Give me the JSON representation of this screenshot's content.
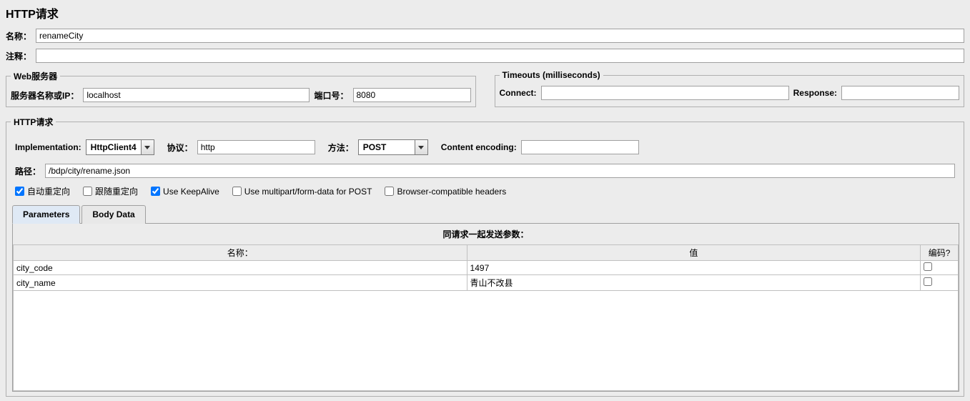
{
  "title": "HTTP请求",
  "top": {
    "name_label": "名称：",
    "name_value": "renameCity",
    "comment_label": "注释：",
    "comment_value": ""
  },
  "webserver": {
    "legend": "Web服务器",
    "server_label": "服务器名称或IP：",
    "server_value": "localhost",
    "port_label": "端口号：",
    "port_value": "8080"
  },
  "timeouts": {
    "legend": "Timeouts (milliseconds)",
    "connect_label": "Connect:",
    "connect_value": "",
    "response_label": "Response:",
    "response_value": ""
  },
  "httpreq": {
    "legend": "HTTP请求",
    "impl_label": "Implementation:",
    "impl_value": "HttpClient4",
    "protocol_label": "协议：",
    "protocol_value": "http",
    "method_label": "方法：",
    "method_value": "POST",
    "enc_label": "Content encoding:",
    "enc_value": "",
    "path_label": "路径：",
    "path_value": "/bdp/city/rename.json",
    "chk_auto_redirect": "自动重定向",
    "chk_follow_redirect": "跟随重定向",
    "chk_keepalive": "Use KeepAlive",
    "chk_multipart": "Use multipart/form-data for POST",
    "chk_browser_headers": "Browser-compatible headers"
  },
  "tabs": {
    "parameters": "Parameters",
    "body_data": "Body Data"
  },
  "params_panel": {
    "title": "同请求一起发送参数：",
    "col_name": "名称：",
    "col_value": "值",
    "col_encode": "编码?",
    "rows": [
      {
        "name": "city_code",
        "value": "1497",
        "encode": false
      },
      {
        "name": "city_name",
        "value": "青山不改县",
        "encode": false
      }
    ]
  }
}
